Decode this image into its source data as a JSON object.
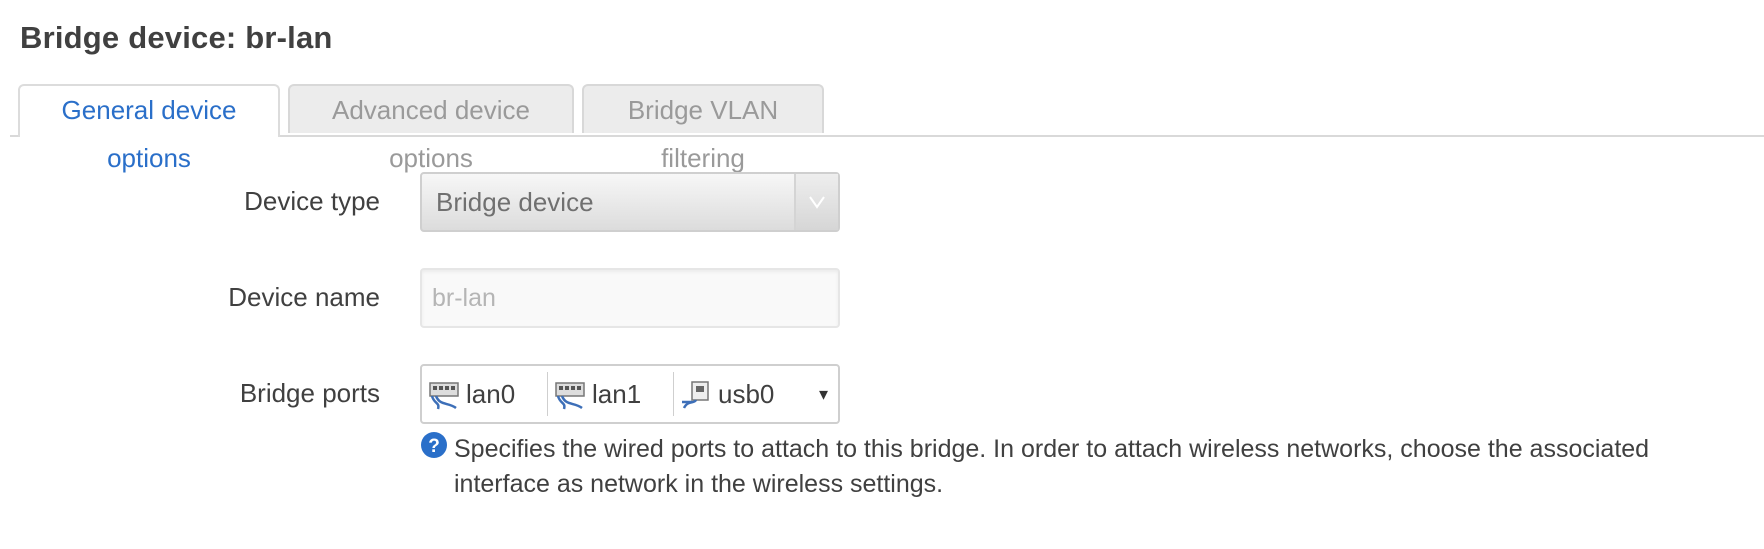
{
  "page": {
    "title": "Bridge device: br-lan"
  },
  "tabs": [
    {
      "label": "General device options",
      "active": true
    },
    {
      "label": "Advanced device options",
      "active": false
    },
    {
      "label": "Bridge VLAN filtering",
      "active": false
    }
  ],
  "form": {
    "device_type": {
      "label": "Device type",
      "value": "Bridge device"
    },
    "device_name": {
      "label": "Device name",
      "placeholder": "br-lan"
    },
    "bridge_ports": {
      "label": "Bridge ports",
      "ports": [
        {
          "name": "lan0",
          "icon": "ethernet-port-icon"
        },
        {
          "name": "lan1",
          "icon": "ethernet-port-icon"
        },
        {
          "name": "usb0",
          "icon": "usb-port-icon"
        }
      ],
      "dropdown_caret": "▾",
      "help": "Specifies the wired ports to attach to this bridge. In order to attach wireless networks, choose the associated interface as network in the wireless settings."
    }
  },
  "colors": {
    "accent": "#2a6fc9",
    "help_icon": "#2a6fc9"
  }
}
